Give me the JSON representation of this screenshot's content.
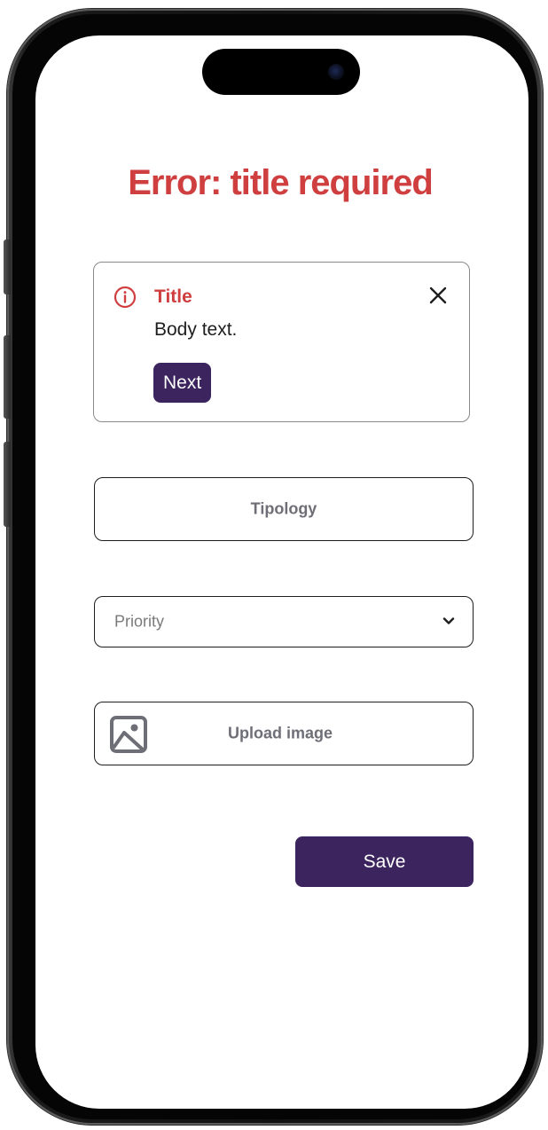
{
  "page": {
    "title": "Error: title required"
  },
  "alert": {
    "title": "Title",
    "body": "Body text.",
    "action_label": "Next",
    "icon": "info-circle-icon",
    "close_icon": "close-icon"
  },
  "form": {
    "tipology_label": "Tipology",
    "priority_placeholder": "Priority",
    "upload_label": "Upload image",
    "upload_icon": "image-icon"
  },
  "actions": {
    "save_label": "Save"
  },
  "colors": {
    "error": "#cf3f3f",
    "primary": "#3c245f",
    "muted_text": "#6e6e76",
    "border": "#1e1e1e"
  }
}
